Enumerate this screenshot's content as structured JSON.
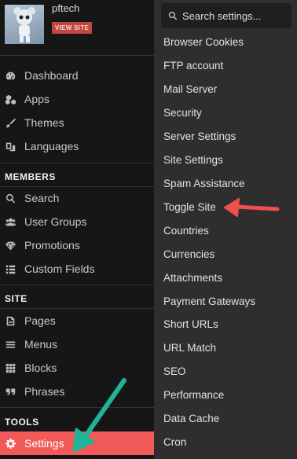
{
  "profile": {
    "username": "pftech",
    "view_site_label": "VIEW SITE"
  },
  "sidebar": {
    "top_items": [
      {
        "label": "Dashboard",
        "icon": "dashboard-icon"
      },
      {
        "label": "Apps",
        "icon": "apps-icon"
      },
      {
        "label": "Themes",
        "icon": "themes-icon"
      },
      {
        "label": "Languages",
        "icon": "languages-icon"
      }
    ],
    "members_heading": "MEMBERS",
    "members_items": [
      {
        "label": "Search",
        "icon": "search-icon"
      },
      {
        "label": "User Groups",
        "icon": "user-groups-icon"
      },
      {
        "label": "Promotions",
        "icon": "diamond-icon"
      },
      {
        "label": "Custom Fields",
        "icon": "list-icon"
      }
    ],
    "site_heading": "SITE",
    "site_items": [
      {
        "label": "Pages",
        "icon": "page-icon"
      },
      {
        "label": "Menus",
        "icon": "menu-icon"
      },
      {
        "label": "Blocks",
        "icon": "grid-icon"
      },
      {
        "label": "Phrases",
        "icon": "quote-icon"
      }
    ],
    "tools_heading": "TOOLS",
    "tools_items": [
      {
        "label": "Settings",
        "icon": "gear-icon",
        "active": true
      }
    ]
  },
  "settings_panel": {
    "search_placeholder": "Search settings...",
    "items": [
      "Browser Cookies",
      "FTP account",
      "Mail Server",
      "Security",
      "Server Settings",
      "Site Settings",
      "Spam Assistance",
      "Toggle Site",
      "Countries",
      "Currencies",
      "Attachments",
      "Payment Gateways",
      "Short URLs",
      "URL Match",
      "SEO",
      "Performance",
      "Data Cache",
      "Cron"
    ]
  },
  "colors": {
    "active": "#f25a5a",
    "arrow_red": "#f04f4f",
    "arrow_teal": "#1fb39a",
    "view_site": "#c0463f"
  }
}
